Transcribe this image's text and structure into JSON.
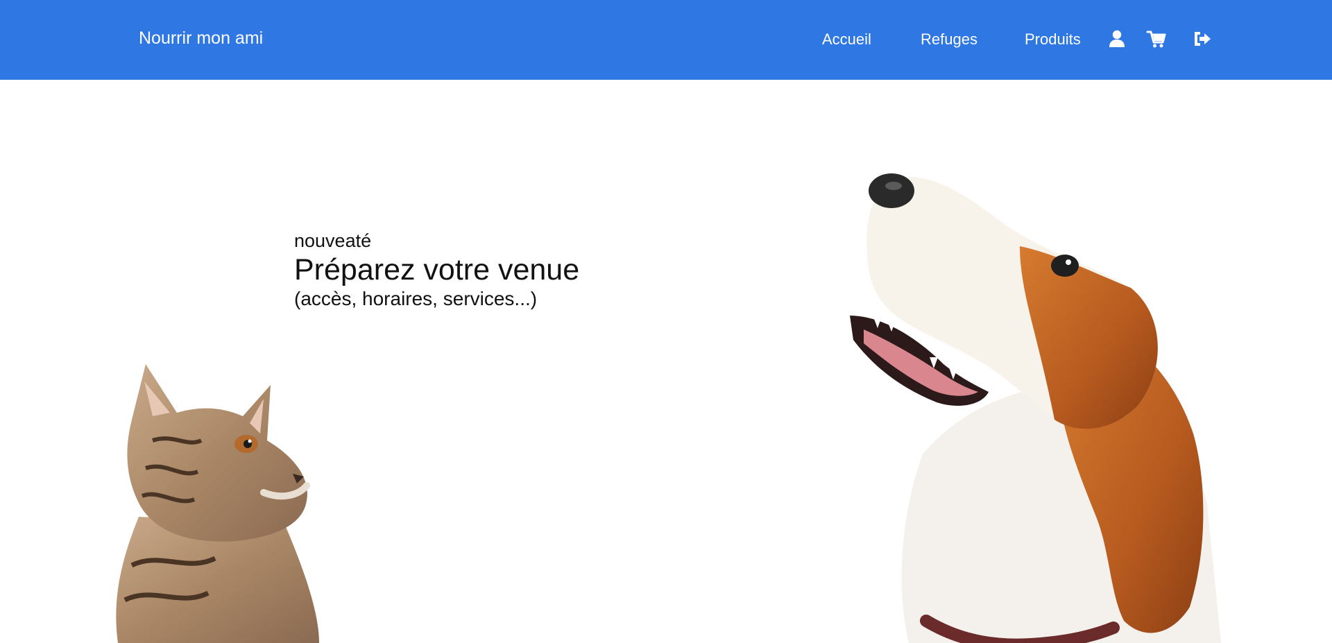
{
  "colors": {
    "brand": "#2f78e4",
    "nav_text": "#ffffff",
    "hero_text": "#111111"
  },
  "navbar": {
    "brand": "Nourrir mon ami",
    "links": [
      {
        "label": "Accueil"
      },
      {
        "label": "Refuges"
      },
      {
        "label": "Produits"
      }
    ],
    "icons": [
      "user-icon",
      "shopping-cart-icon",
      "sign-out-icon"
    ]
  },
  "hero": {
    "kicker": "nouveaté",
    "title": "Préparez votre venue",
    "subtitle": "(accès, horaires, services...)",
    "images": [
      "kitten-image",
      "dog-image"
    ]
  }
}
